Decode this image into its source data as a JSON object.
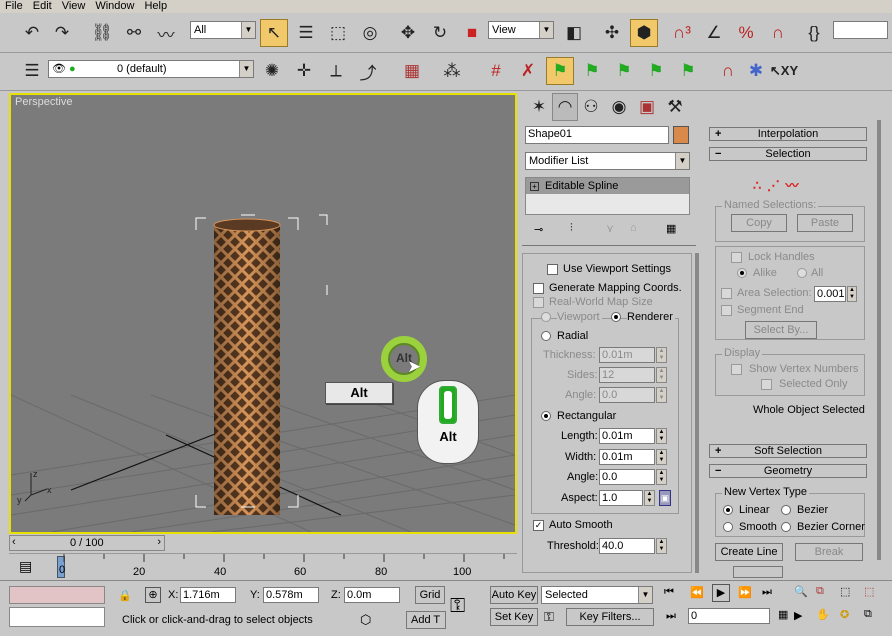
{
  "menu": [
    "File",
    "Edit",
    "View",
    "Window",
    "Help"
  ],
  "toolbar1": {
    "selection_filter": "All",
    "ref_coord": "View"
  },
  "toolbar2": {
    "layer": "0 (default)"
  },
  "viewport": {
    "label": "Perspective",
    "alt_key": "Alt",
    "mouse_alt": "Alt",
    "alt_ring": "Alt"
  },
  "timeline": {
    "frame": "0 / 100",
    "ticks": [
      "0",
      "20",
      "40",
      "60",
      "80",
      "100"
    ]
  },
  "status": {
    "x_label": "X:",
    "x_value": "1.716m",
    "y_label": "Y:",
    "y_value": "0.578m",
    "z_label": "Z:",
    "z_value": "0.0m",
    "grid": "Grid",
    "prompt": "Click or click-and-drag to select objects",
    "add_time": "Add T",
    "auto_key": "Auto Key",
    "set_key": "Set Key",
    "key_mode": "Selected",
    "key_filters": "Key Filters...",
    "frame_value": "0"
  },
  "modify": {
    "object_name": "Shape01",
    "object_color": "#d98a4a",
    "modifier_list": "Modifier List",
    "stack_item": "Editable Spline",
    "use_viewport": "Use Viewport Settings",
    "gen_mapping": "Generate Mapping Coords.",
    "real_world": "Real-World Map Size",
    "viewport_opt": "Viewport",
    "renderer_opt": "Renderer",
    "radial": "Radial",
    "thickness_label": "Thickness:",
    "thickness": "0.01m",
    "sides_label": "Sides:",
    "sides": "12",
    "angle_label": "Angle:",
    "angle": "0.0",
    "rectangular": "Rectangular",
    "length_label": "Length:",
    "length": "0.01m",
    "width_label": "Width:",
    "width": "0.01m",
    "angle2_label": "Angle:",
    "angle2": "0.0",
    "aspect_label": "Aspect:",
    "aspect": "1.0",
    "auto_smooth": "Auto Smooth",
    "threshold_label": "Threshold:",
    "threshold": "40.0"
  },
  "rollouts": {
    "interpolation": "Interpolation",
    "selection": "Selection",
    "named_selections": "Named Selections:",
    "copy": "Copy",
    "paste": "Paste",
    "lock_handles": "Lock Handles",
    "alike": "Alike",
    "all": "All",
    "area_selection": "Area Selection:",
    "area_value": "0.001m",
    "segment_end": "Segment End",
    "select_by": "Select By...",
    "display": "Display",
    "show_vertex_numbers": "Show Vertex Numbers",
    "selected_only": "Selected Only",
    "whole_object": "Whole Object Selected",
    "soft_selection": "Soft Selection",
    "geometry": "Geometry",
    "new_vertex_type": "New Vertex Type",
    "linear": "Linear",
    "bezier": "Bezier",
    "smooth": "Smooth",
    "bezier_corner": "Bezier Corner",
    "create_line": "Create Line",
    "break": "Break"
  }
}
